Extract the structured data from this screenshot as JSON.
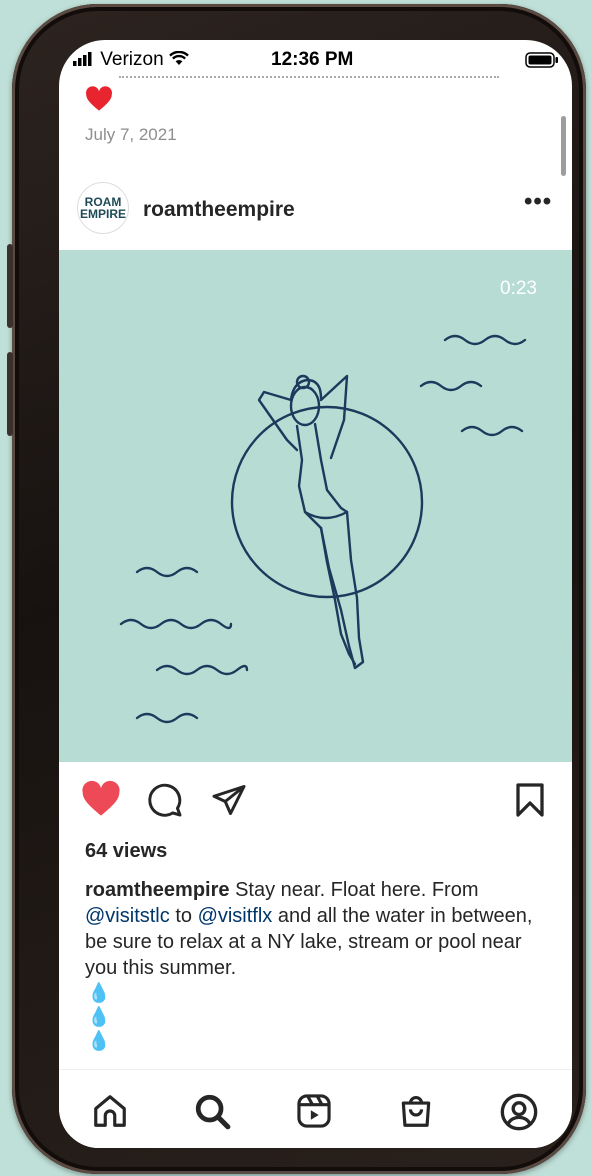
{
  "status_bar": {
    "carrier": "Verizon",
    "time": "12:36 PM"
  },
  "previous_post": {
    "date": "July 7, 2021"
  },
  "post": {
    "username": "roamtheempire",
    "avatar_logo": [
      "ROAM",
      "EMPIRE"
    ],
    "more_label": "•••",
    "video_duration": "0:23",
    "liked": true,
    "views": "64 views",
    "caption": {
      "user": "roamtheempire",
      "text1": "Stay near. Float here. From",
      "mention1": "@visitstlc",
      "text2": "to",
      "mention2": "@visitflx",
      "text3": "and all the water in between, be sure to relax at a NY lake, stream or pool near you this summer.",
      "emojis": [
        "💧",
        "💧",
        "💧"
      ]
    }
  },
  "colors": {
    "media_background": "#b6dcd4",
    "illustration_line": "#1b3a5c",
    "like_red": "#ed4956",
    "mention_blue": "#00376b"
  },
  "tab_bar": {
    "tabs": [
      "home-icon",
      "search-icon",
      "reels-icon",
      "shop-icon",
      "profile-icon"
    ],
    "active": "search-icon"
  }
}
